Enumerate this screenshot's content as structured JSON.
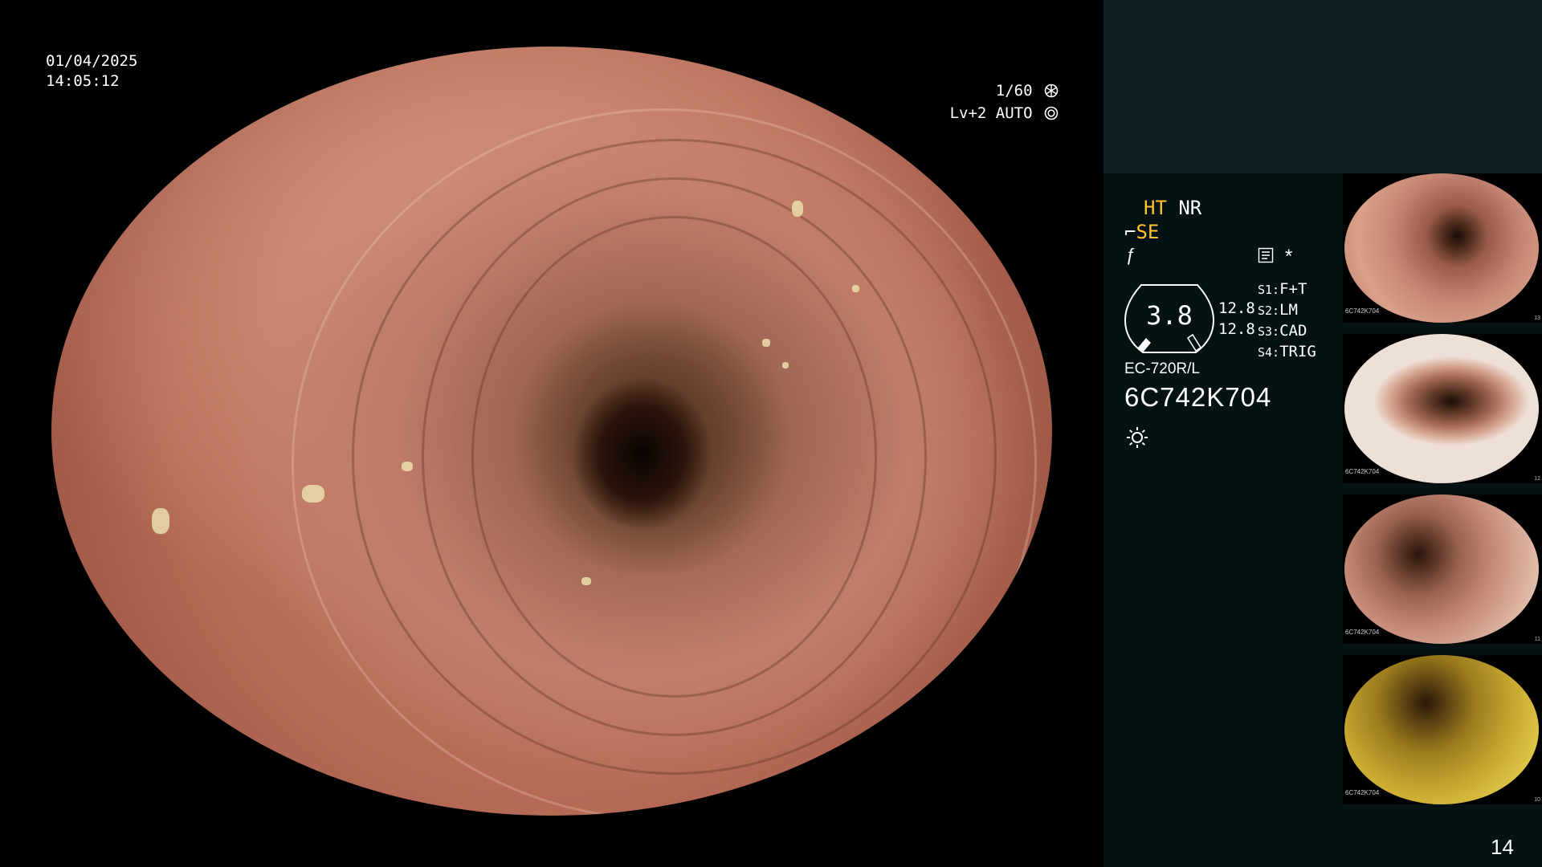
{
  "overlay": {
    "date": "01/04/2025",
    "time": "14:05:12",
    "shutter": "1/60",
    "level": "Lv+2 AUTO"
  },
  "panel": {
    "ht_label": "HT",
    "nr_label": "NR",
    "se_label": "SE",
    "gauge_value": "3.8",
    "gauge_num_1": "12.8",
    "gauge_num_2": "12.8",
    "slots": [
      {
        "key": "S1:",
        "value": "F+T"
      },
      {
        "key": "S2:",
        "value": "LM"
      },
      {
        "key": "S3:",
        "value": "CAD"
      },
      {
        "key": "S4:",
        "value": "TRIG"
      }
    ],
    "model": "EC-720R/L",
    "serial": "6C742K704",
    "accent_color": "#ffc42e"
  },
  "thumbnails": [
    {
      "serial": "6C742K704",
      "index": "13"
    },
    {
      "serial": "6C742K704",
      "index": "12"
    },
    {
      "serial": "6C742K704",
      "index": "11"
    },
    {
      "serial": "6C742K704",
      "index": "10"
    }
  ],
  "page_number": "14"
}
